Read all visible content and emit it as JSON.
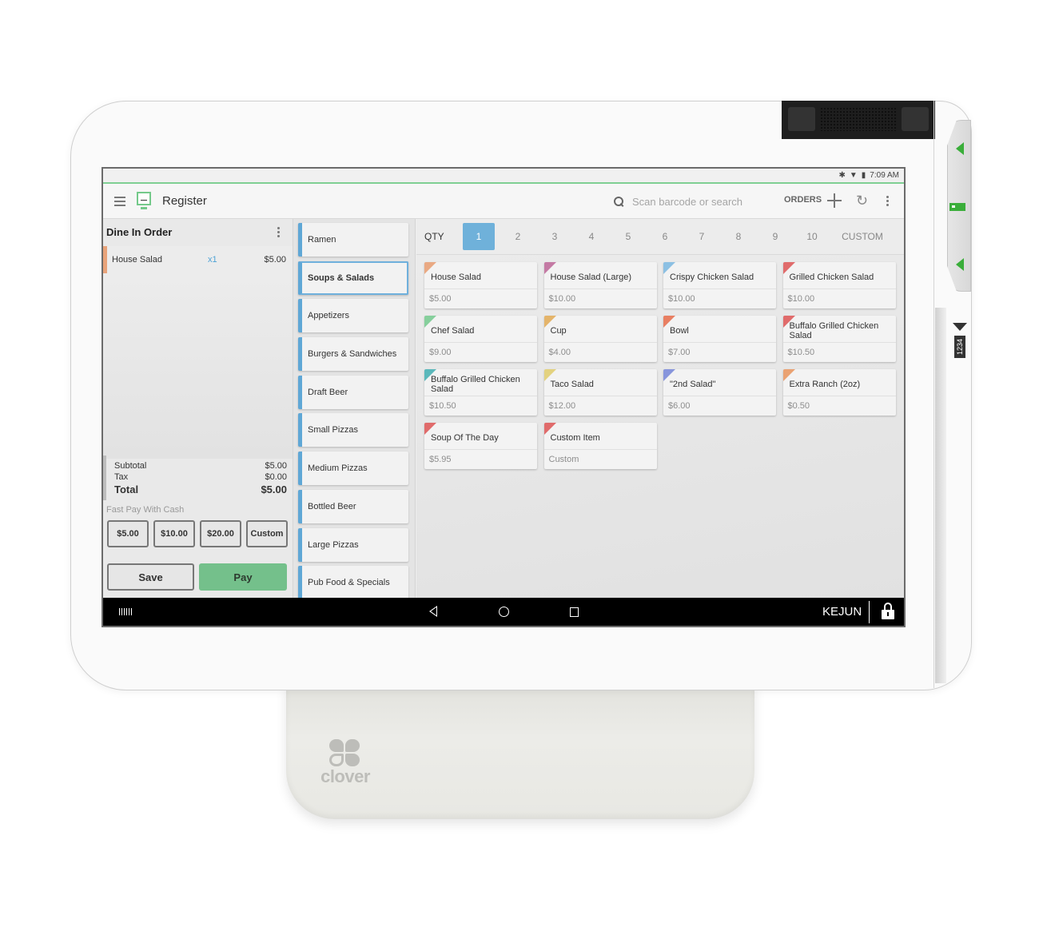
{
  "device": {
    "brand": "clover",
    "side_tag": "1234"
  },
  "status_bar": {
    "icons": [
      "bluetooth-icon",
      "wifi-icon",
      "battery-icon"
    ],
    "time": "7:09 AM"
  },
  "app_bar": {
    "title": "Register",
    "search_placeholder": "Scan barcode or search",
    "orders_label": "ORDERS",
    "accent_color": "#74c98a"
  },
  "order": {
    "title": "Dine In Order",
    "lines": [
      {
        "name": "House Salad",
        "qty": "x1",
        "price": "$5.00"
      }
    ],
    "subtotal_label": "Subtotal",
    "subtotal": "$5.00",
    "tax_label": "Tax",
    "tax": "$0.00",
    "total_label": "Total",
    "total": "$5.00",
    "fast_pay_label": "Fast Pay With Cash",
    "cash_options": [
      "$5.00",
      "$10.00",
      "$20.00",
      "Custom"
    ],
    "save_label": "Save",
    "pay_label": "Pay",
    "pay_color": "#74c08b"
  },
  "categories": {
    "selected": "Soups & Salads",
    "items": [
      "Ramen",
      "Soups & Salads",
      "Appetizers",
      "Burgers & Sandwiches",
      "Draft Beer",
      "Small Pizzas",
      "Medium Pizzas",
      "Bottled Beer",
      "Large Pizzas",
      "Pub Food & Specials"
    ]
  },
  "quantity": {
    "label": "QTY",
    "selected": "1",
    "options": [
      "1",
      "2",
      "3",
      "4",
      "5",
      "6",
      "7",
      "8",
      "9",
      "10",
      "CUSTOM"
    ],
    "selected_color": "#6fb1da"
  },
  "items": [
    {
      "name": "House Salad",
      "price": "$5.00",
      "color": "#e9a983"
    },
    {
      "name": "House Salad (Large)",
      "price": "$10.00",
      "color": "#c47aa4"
    },
    {
      "name": "Crispy Chicken Salad",
      "price": "$10.00",
      "color": "#8cc0e3"
    },
    {
      "name": "Grilled Chicken Salad",
      "price": "$10.00",
      "color": "#e06b6b"
    },
    {
      "name": "Chef Salad",
      "price": "$9.00",
      "color": "#86cf9c"
    },
    {
      "name": "Cup",
      "price": "$4.00",
      "color": "#e4b46a"
    },
    {
      "name": "Bowl",
      "price": "$7.00",
      "color": "#e87f62"
    },
    {
      "name": "Buffalo Grilled Chicken Salad",
      "price": "$10.50",
      "color": "#e06b6b"
    },
    {
      "name": "Buffalo Grilled Chicken Salad",
      "price": "$10.50",
      "color": "#5bb8bb"
    },
    {
      "name": "Taco Salad",
      "price": "$12.00",
      "color": "#e3d27f"
    },
    {
      "name": "\"2nd Salad\"",
      "price": "$6.00",
      "color": "#8795dc"
    },
    {
      "name": "Extra Ranch (2oz)",
      "price": "$0.50",
      "color": "#eaa272"
    },
    {
      "name": "Soup Of The Day",
      "price": "$5.95",
      "color": "#e06b6b"
    },
    {
      "name": "Custom Item",
      "price": "Custom",
      "color": "#e06b6b"
    }
  ],
  "nav_bar": {
    "user": "KEJUN"
  }
}
